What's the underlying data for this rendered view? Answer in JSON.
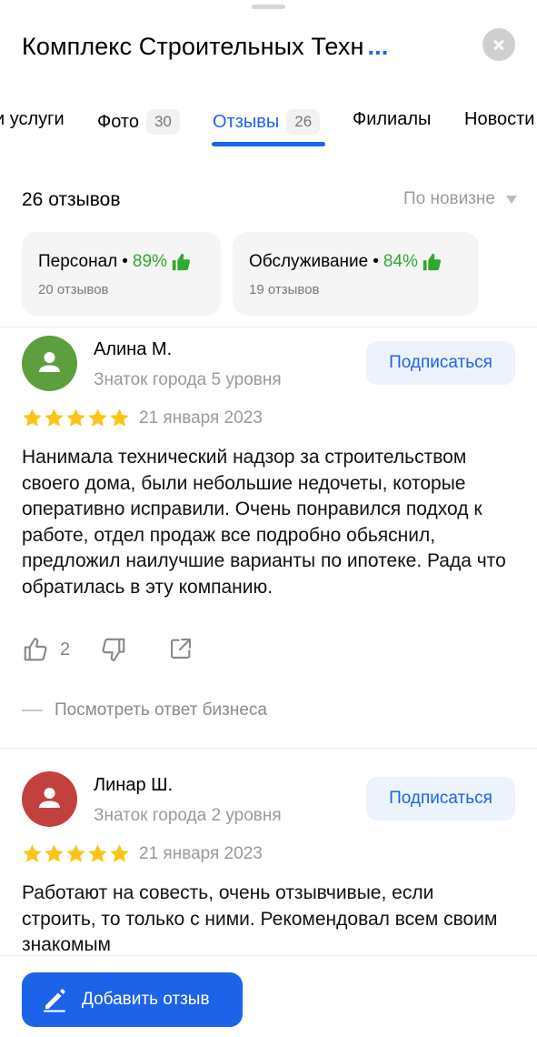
{
  "header": {
    "title": "Комплекс Строительных Техн",
    "title_more": "...",
    "close_icon": "close-icon"
  },
  "tabs": [
    {
      "label": "и услуги",
      "badge": "",
      "active": false
    },
    {
      "label": "Фото",
      "badge": "30",
      "active": false
    },
    {
      "label": "Отзывы",
      "badge": "26",
      "active": true
    },
    {
      "label": "Филиалы",
      "badge": "",
      "active": false
    },
    {
      "label": "Новости",
      "badge": "",
      "active": false
    }
  ],
  "reviews_summary": {
    "count_label": "26 отзывов",
    "sort_label": "По новизне"
  },
  "aspects": [
    {
      "name": "Персонал",
      "dot": "•",
      "percent": "89%",
      "sub": "20 отзывов"
    },
    {
      "name": "Обслуживание",
      "dot": "•",
      "percent": "84%",
      "sub": "19 отзывов"
    }
  ],
  "reviews": [
    {
      "author": "Алина М.",
      "level": "Знаток города 5 уровня",
      "avatar_color": "#5d9e3e",
      "subscribe_label": "Подписаться",
      "rating": 5,
      "date": "21 января 2023",
      "text": "Нанимала технический надзор за строительством своего дома, были небольшие недочеты, которые оперативно исправили. Очень понравился подход к работе, отдел продаж все подробно обьяснил, предложил наилучшие варианты по ипотеке. Рада что обратилась в эту компанию.",
      "likes": "2",
      "business_reply_label": "Посмотреть ответ бизнеса"
    },
    {
      "author": "Линар Ш.",
      "level": "Знаток города 2 уровня",
      "avatar_color": "#c2413f",
      "subscribe_label": "Подписаться",
      "rating": 5,
      "date": "21 января 2023",
      "text": "Работают на совесть, очень отзывчивые, если строить, то только с ними. Рекомендовал всем своим знакомым"
    }
  ],
  "bottom": {
    "add_review_label": "Добавить отзыв"
  },
  "colors": {
    "accent": "#1d63e8",
    "positive": "#2fa92f",
    "star": "#fcc419"
  }
}
